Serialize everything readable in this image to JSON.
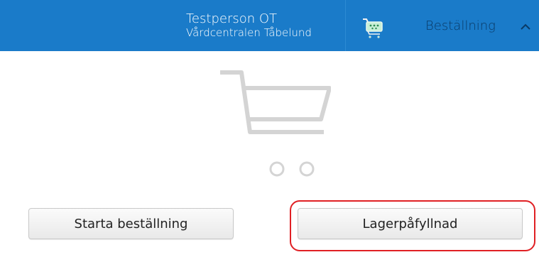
{
  "header": {
    "user_name": "Testperson OT",
    "organization": "Vårdcentralen Tåbelund",
    "cart_icon": "shopping-cart-icon",
    "order_label": "Beställning",
    "expand_icon": "chevron-up-icon",
    "colors": {
      "bar_background": "#1a7bc9",
      "order_label": "#0a3a66"
    }
  },
  "main": {
    "empty_cart_icon": "shopping-cart-icon",
    "start_order_label": "Starta beställning",
    "restock_label": "Lagerpåfyllnad",
    "highlight_color": "#e02024"
  }
}
